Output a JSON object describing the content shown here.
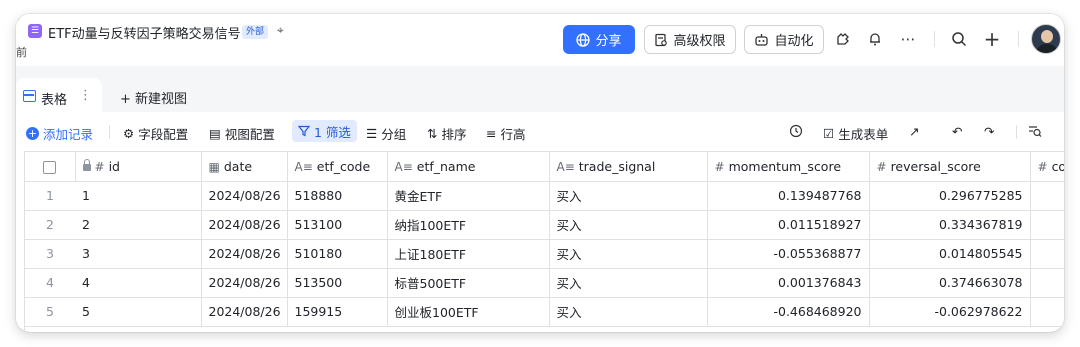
{
  "header": {
    "title": "ETF动量与反转因子策略交易信号",
    "badge": "外部",
    "fragment_left": "前",
    "share_label": "分享",
    "permission_label": "高级权限",
    "automation_label": "自动化"
  },
  "tabs": {
    "active_label": "表格",
    "new_view_label": "+ 新建视图"
  },
  "toolbar": {
    "add_record": "添加记录",
    "field_config": "字段配置",
    "view_config": "视图配置",
    "filter": "1 筛选",
    "group": "分组",
    "sort": "排序",
    "row_height": "行高",
    "create_form": "生成表单"
  },
  "table": {
    "columns": [
      {
        "icon": "#",
        "label": "id"
      },
      {
        "icon": "▦",
        "label": "date"
      },
      {
        "icon": "A≡",
        "label": "etf_code"
      },
      {
        "icon": "A≡",
        "label": "etf_name"
      },
      {
        "icon": "A≡",
        "label": "trade_signal"
      },
      {
        "icon": "#",
        "label": "momentum_score"
      },
      {
        "icon": "#",
        "label": "reversal_score"
      },
      {
        "icon": "#",
        "label": "com"
      }
    ],
    "rows": [
      {
        "n": "1",
        "id": "1",
        "date": "2024/08/26",
        "code": "518880",
        "name": "黄金ETF",
        "signal": "买入",
        "mom": "0.139487768",
        "rev": "0.296775285"
      },
      {
        "n": "2",
        "id": "2",
        "date": "2024/08/26",
        "code": "513100",
        "name": "纳指100ETF",
        "signal": "买入",
        "mom": "0.011518927",
        "rev": "0.334367819"
      },
      {
        "n": "3",
        "id": "3",
        "date": "2024/08/26",
        "code": "510180",
        "name": "上证180ETF",
        "signal": "买入",
        "mom": "-0.055368877",
        "rev": "0.014805545"
      },
      {
        "n": "4",
        "id": "4",
        "date": "2024/08/26",
        "code": "513500",
        "name": "标普500ETF",
        "signal": "买入",
        "mom": "0.001376843",
        "rev": "0.374663078"
      },
      {
        "n": "5",
        "id": "5",
        "date": "2024/08/26",
        "code": "159915",
        "name": "创业板100ETF",
        "signal": "买入",
        "mom": "-0.468468920",
        "rev": "-0.062978622"
      }
    ]
  },
  "colors": {
    "accent": "#3370ff",
    "badge_bg": "#e1eaff",
    "doc_icon": "#8f67f1"
  }
}
